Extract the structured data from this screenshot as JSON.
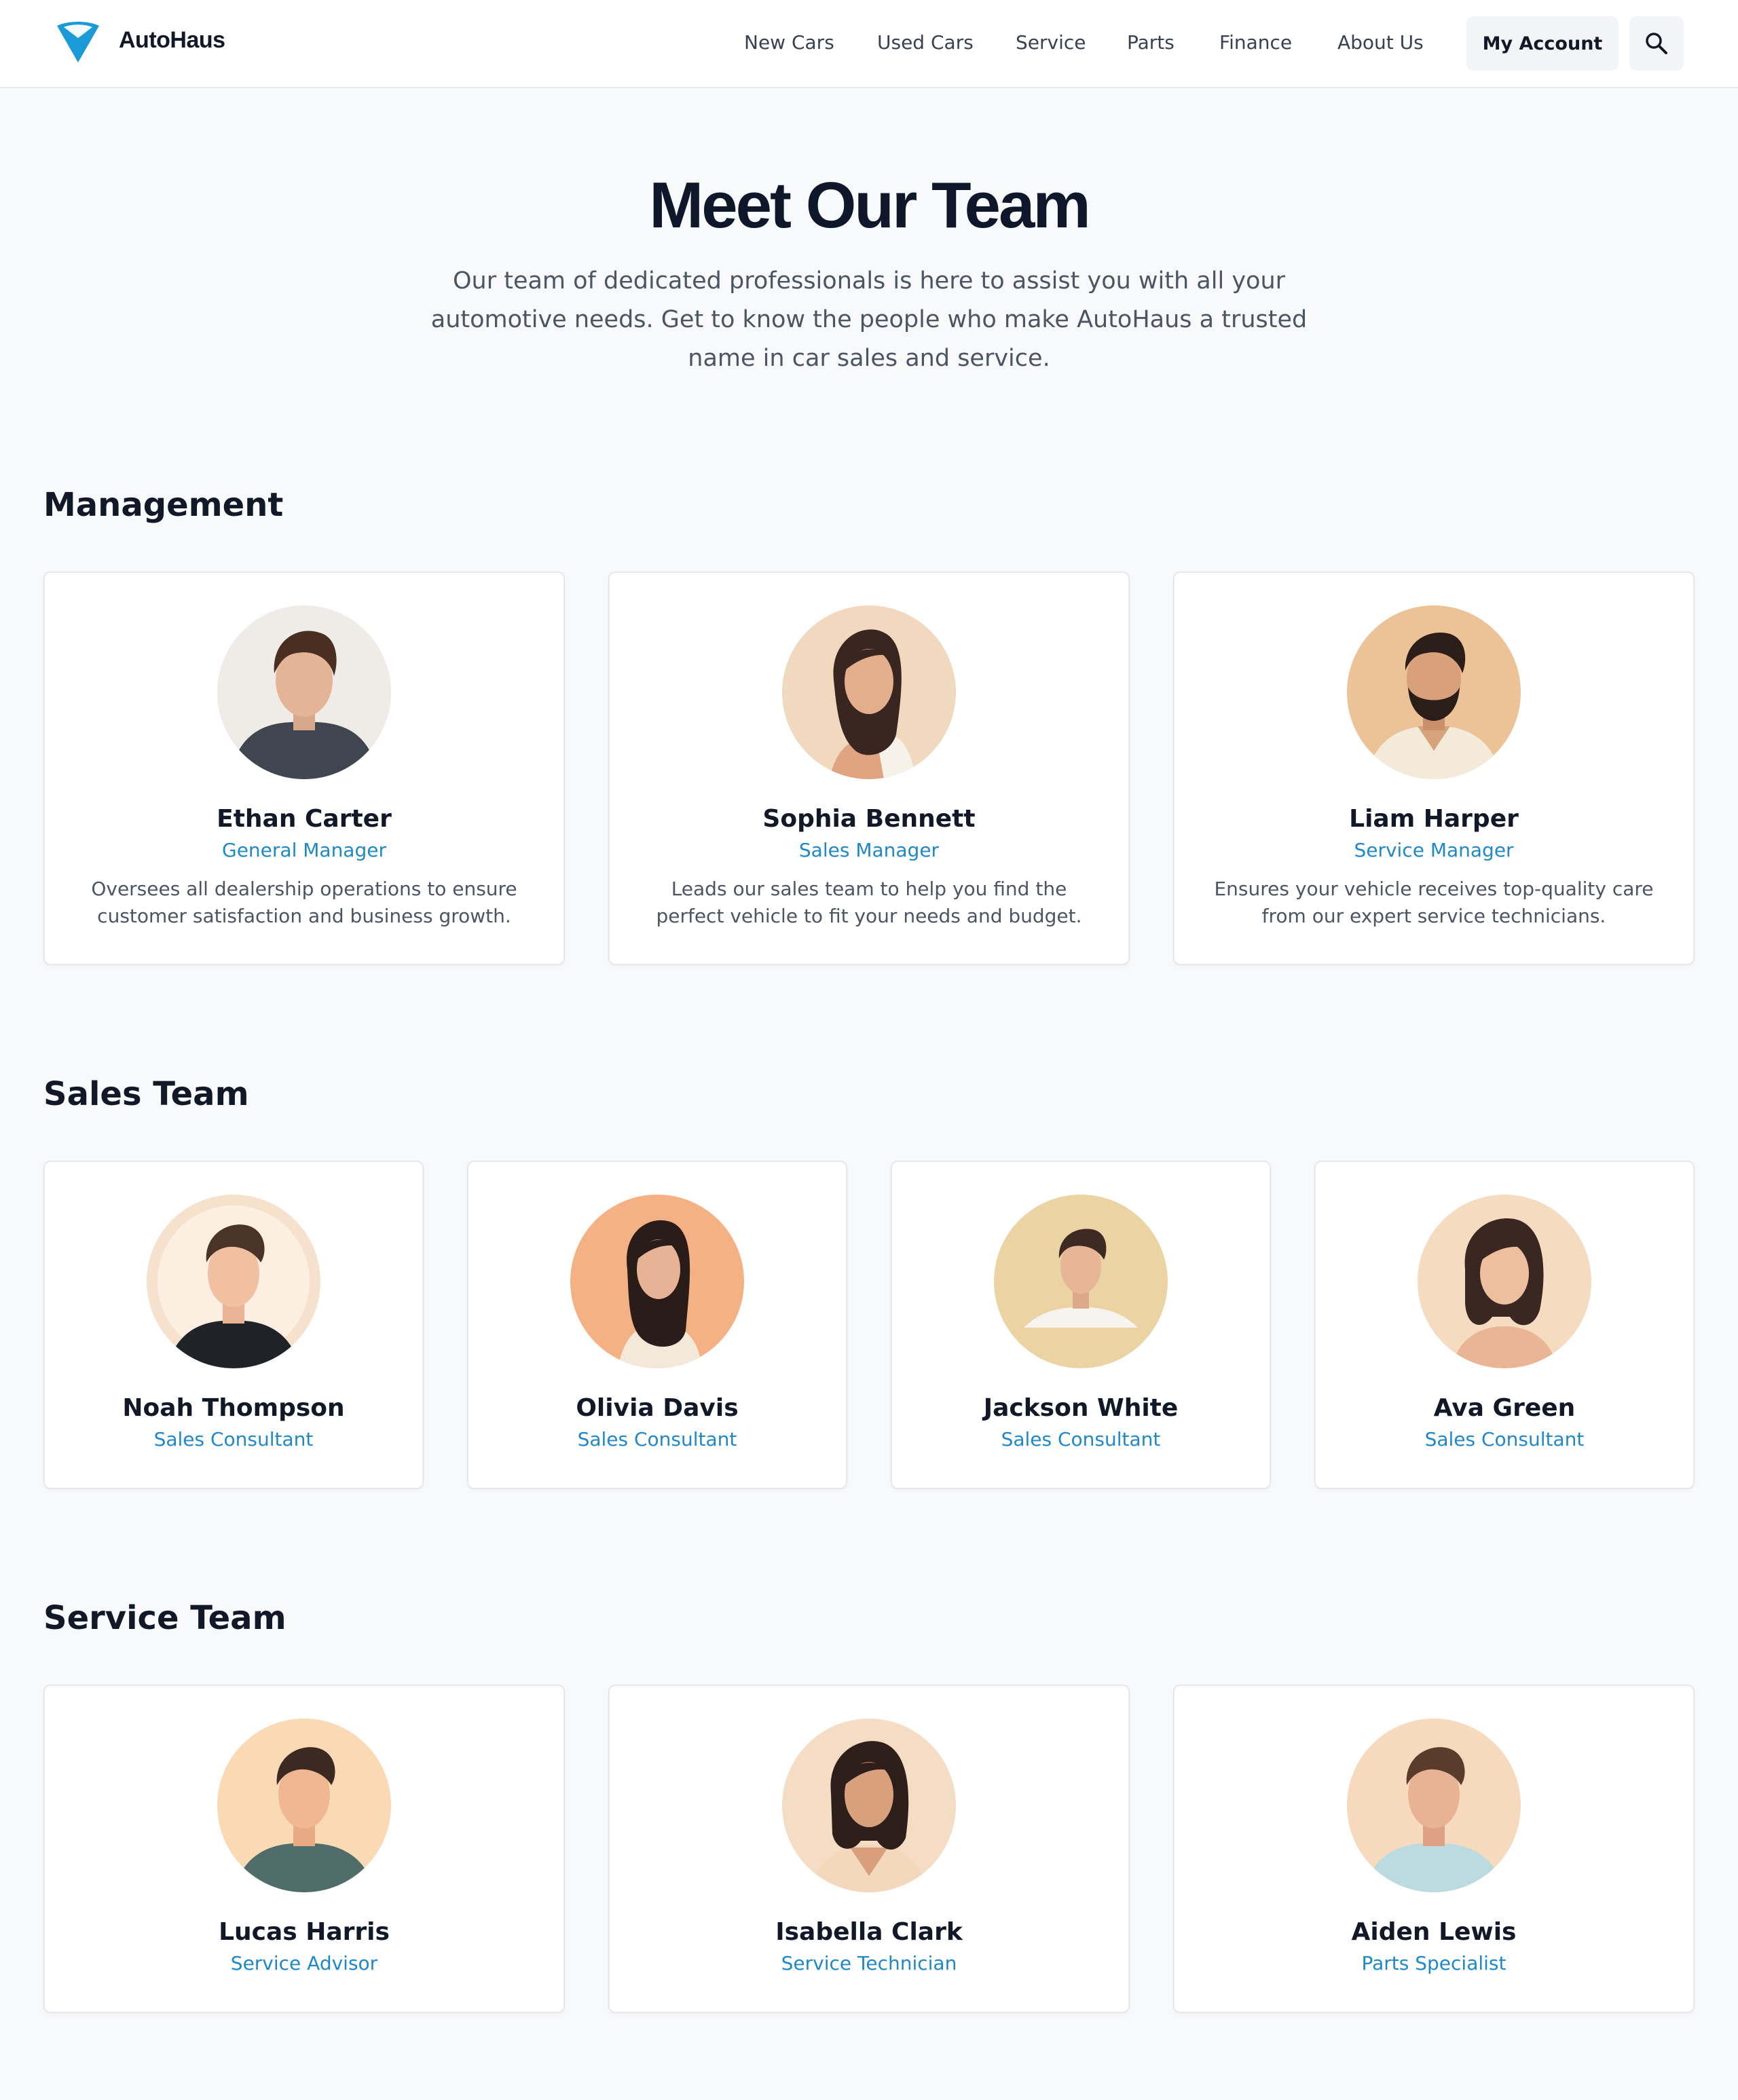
{
  "header": {
    "brand": "AutoHaus",
    "nav": [
      "New Cars",
      "Used Cars",
      "Service",
      "Parts",
      "Finance",
      "About Us"
    ],
    "account_label": "My Account"
  },
  "hero": {
    "title": "Meet Our Team",
    "subtitle": "Our team of dedicated professionals is here to assist you with all your automotive needs. Get to know the people who make AutoHaus a trusted name in car sales and service."
  },
  "sections": {
    "management": {
      "title": "Management",
      "members": [
        {
          "name": "Ethan Carter",
          "role": "General Manager",
          "desc": "Oversees all dealership operations to ensure customer satisfaction and business growth."
        },
        {
          "name": "Sophia Bennett",
          "role": "Sales Manager",
          "desc": "Leads our sales team to help you find the perfect vehicle to fit your needs and budget."
        },
        {
          "name": "Liam Harper",
          "role": "Service Manager",
          "desc": "Ensures your vehicle receives top-quality care from our expert service technicians."
        }
      ]
    },
    "sales": {
      "title": "Sales Team",
      "members": [
        {
          "name": "Noah Thompson",
          "role": "Sales Consultant"
        },
        {
          "name": "Olivia Davis",
          "role": "Sales Consultant"
        },
        {
          "name": "Jackson White",
          "role": "Sales Consultant"
        },
        {
          "name": "Ava Green",
          "role": "Sales Consultant"
        }
      ]
    },
    "service": {
      "title": "Service Team",
      "members": [
        {
          "name": "Lucas Harris",
          "role": "Service Advisor"
        },
        {
          "name": "Isabella Clark",
          "role": "Service Technician"
        },
        {
          "name": "Aiden Lewis",
          "role": "Parts Specialist"
        }
      ]
    }
  },
  "colors": {
    "accent": "#1e88c9",
    "logo": "#1a9ad6",
    "heading": "#0f172a",
    "body_text": "#4b5563"
  },
  "icons": {
    "logo": "funnel-logo-icon",
    "search": "search-icon"
  }
}
